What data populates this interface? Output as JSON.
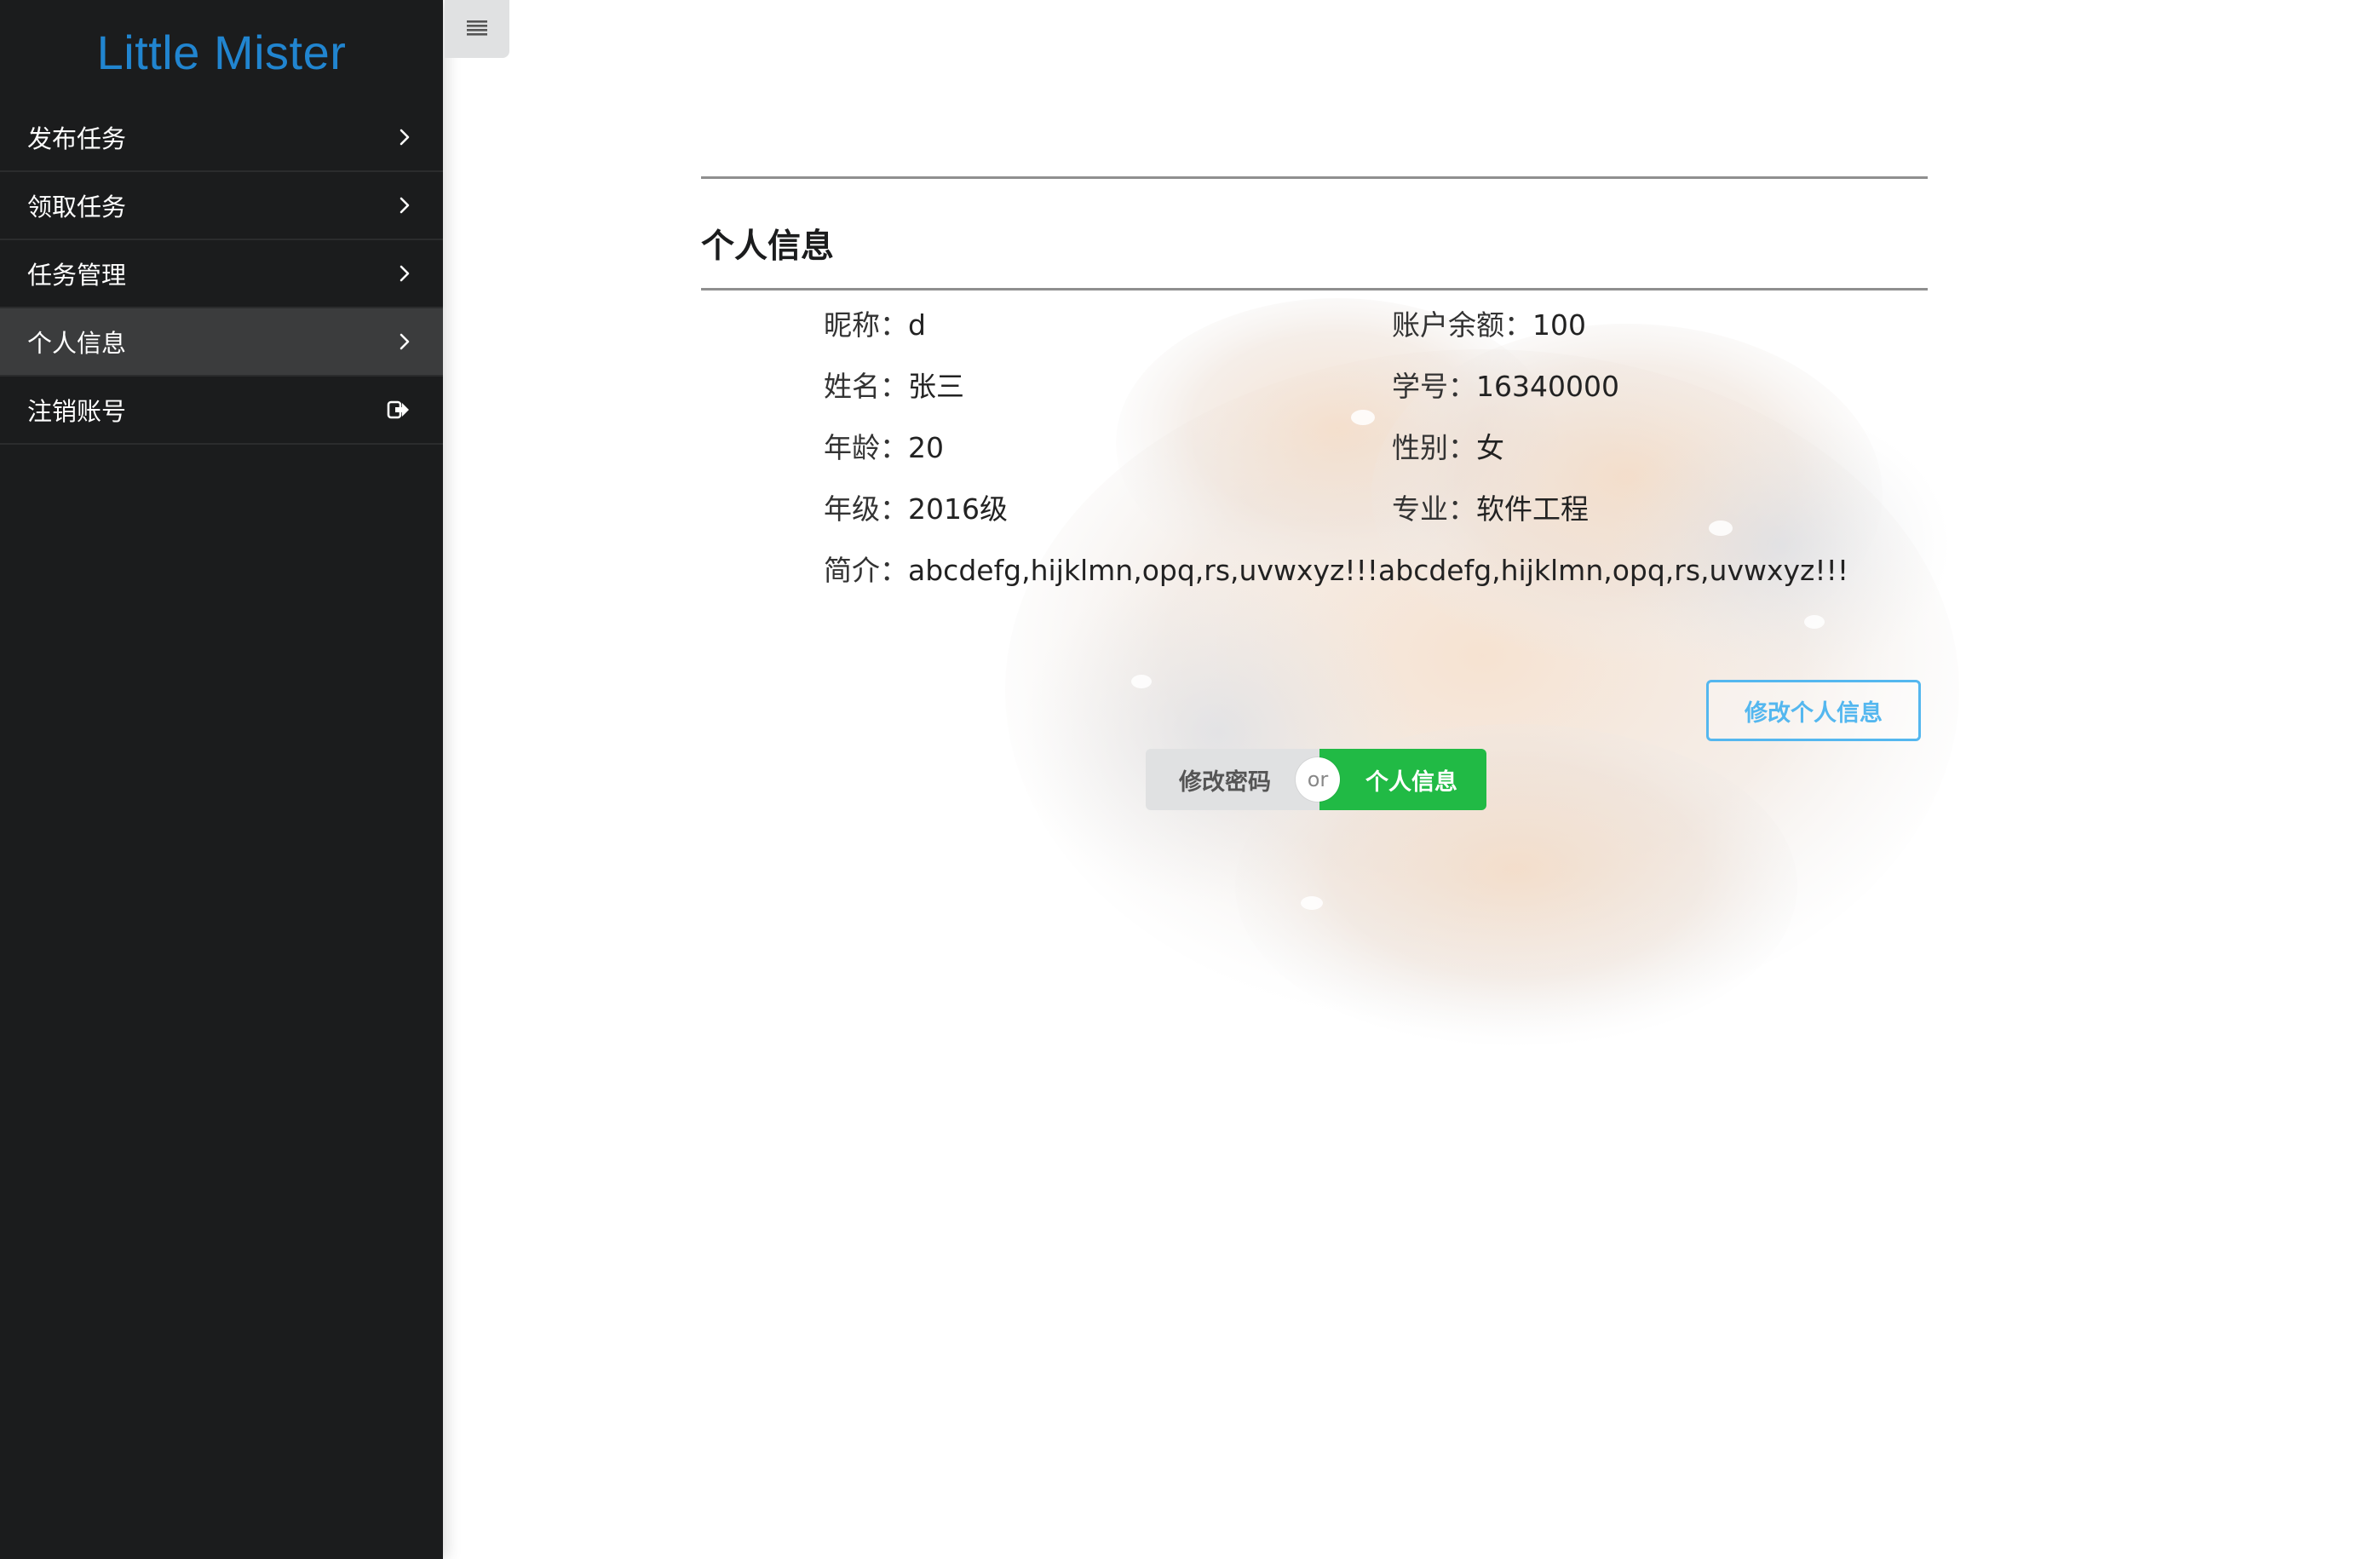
{
  "app": {
    "brand": "Little Mister"
  },
  "sidebar": {
    "items": [
      {
        "label": "发布任务",
        "icon": "chevron-right-icon",
        "active": false
      },
      {
        "label": "领取任务",
        "icon": "chevron-right-icon",
        "active": false
      },
      {
        "label": "任务管理",
        "icon": "chevron-right-icon",
        "active": false
      },
      {
        "label": "个人信息",
        "icon": "chevron-right-icon",
        "active": true
      },
      {
        "label": "注销账号",
        "icon": "sign-out-icon",
        "active": false
      }
    ]
  },
  "toggle": {
    "icon": "hamburger-menu-icon"
  },
  "profile": {
    "section_title": "个人信息",
    "nickname_label": "昵称：",
    "nickname": "d",
    "balance_label": "账户余额：",
    "balance": "100",
    "name_label": "姓名：",
    "name": "张三",
    "student_id_label": "学号：",
    "student_id": "16340000",
    "age_label": "年龄：",
    "age": "20",
    "gender_label": "性别：",
    "gender": "女",
    "grade_label": "年级：",
    "grade": "2016级",
    "major_label": "专业：",
    "major": "软件工程",
    "bio_label": "简介：",
    "bio": "abcdefg,hijklmn,opq,rs,uvwxyz!!!abcdefg,hijklmn,opq,rs,uvwxyz!!!"
  },
  "actions": {
    "edit_profile": "修改个人信息",
    "change_password": "修改密码",
    "or": "or",
    "profile": "个人信息"
  },
  "colors": {
    "sidebar_bg": "#1b1c1d",
    "brand": "#2185d0",
    "primary_outline": "#54b7ef",
    "success": "#21ba45"
  }
}
